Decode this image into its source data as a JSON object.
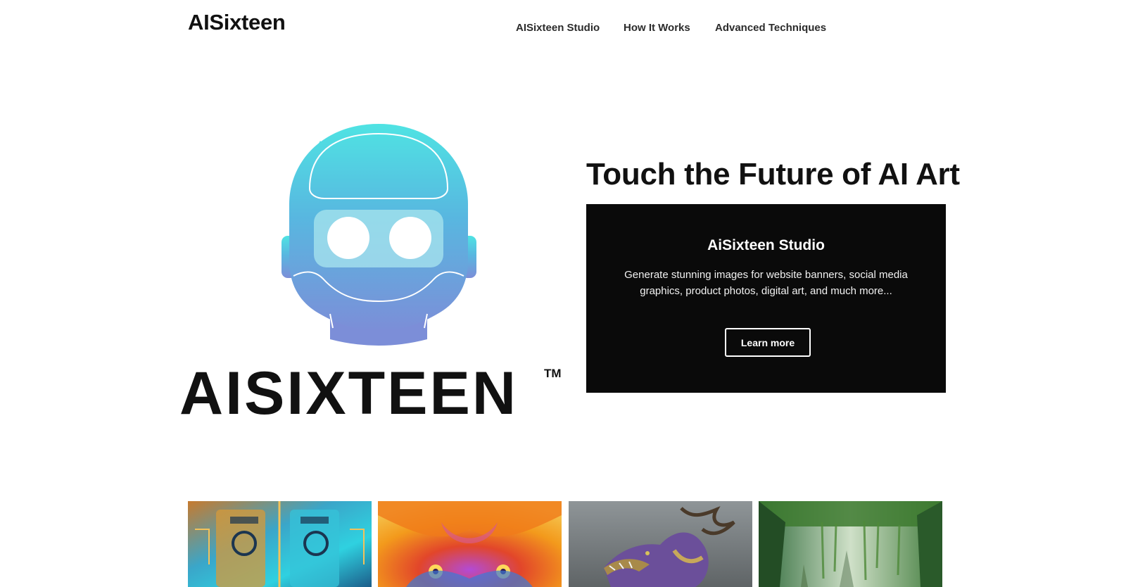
{
  "header": {
    "site_title": "AISixteen",
    "nav": [
      {
        "label": "AISixteen Studio"
      },
      {
        "label": "How It Works"
      },
      {
        "label": "Advanced Techniques"
      }
    ]
  },
  "hero": {
    "logo_wordmark": "AISIXTEEN",
    "logo_trademark": "TM",
    "heading": "Touch the Future of AI Art",
    "card": {
      "title": "AiSixteen Studio",
      "description": "Generate stunning images for website banners, social media graphics, product photos, digital art, and much more...",
      "button_label": "Learn more"
    }
  },
  "gallery": {
    "items": [
      {
        "icon": "circuit-art-image"
      },
      {
        "icon": "psychedelic-creature-image"
      },
      {
        "icon": "dragon-image"
      },
      {
        "icon": "jungle-ruins-image"
      }
    ]
  },
  "colors": {
    "logo_gradient_top": "#4fe3e3",
    "logo_gradient_bottom": "#7c8ed8",
    "card_background": "#0a0a0a"
  }
}
